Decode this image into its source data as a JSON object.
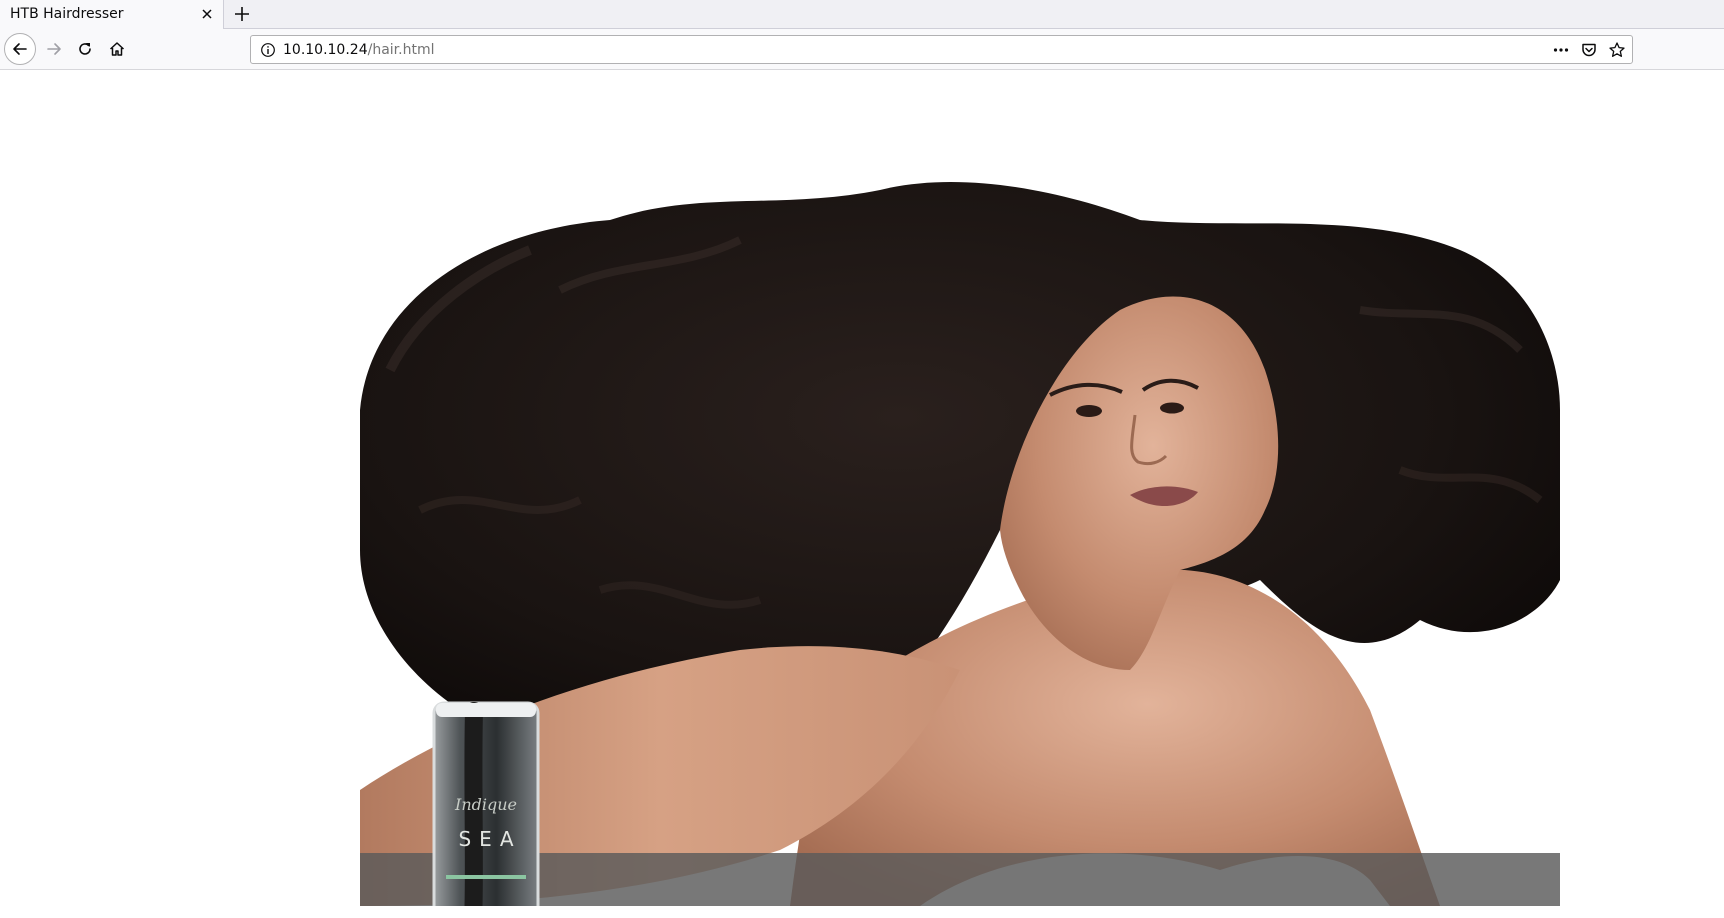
{
  "browser": {
    "tab": {
      "title": "HTB Hairdresser"
    },
    "url": {
      "host": "10.10.10.24",
      "path": "/hair.html"
    },
    "icons": {
      "back": "back-arrow-icon",
      "forward": "forward-arrow-icon",
      "reload": "reload-icon",
      "home": "home-icon",
      "info": "info-icon",
      "page_actions": "more-dots-icon",
      "pocket": "pocket-icon",
      "bookmark": "star-icon",
      "close_tab": "close-icon",
      "new_tab": "plus-icon"
    }
  },
  "page": {
    "hero": {
      "product": {
        "brand": "Indique",
        "name": "SEA"
      }
    }
  },
  "colors": {
    "chrome_bg": "#f9f9fb",
    "tabstrip_bg": "#f0f0f4",
    "hair": "#1b1513",
    "skin": "#c9967b",
    "caption_bar": "#5a5a5a"
  }
}
